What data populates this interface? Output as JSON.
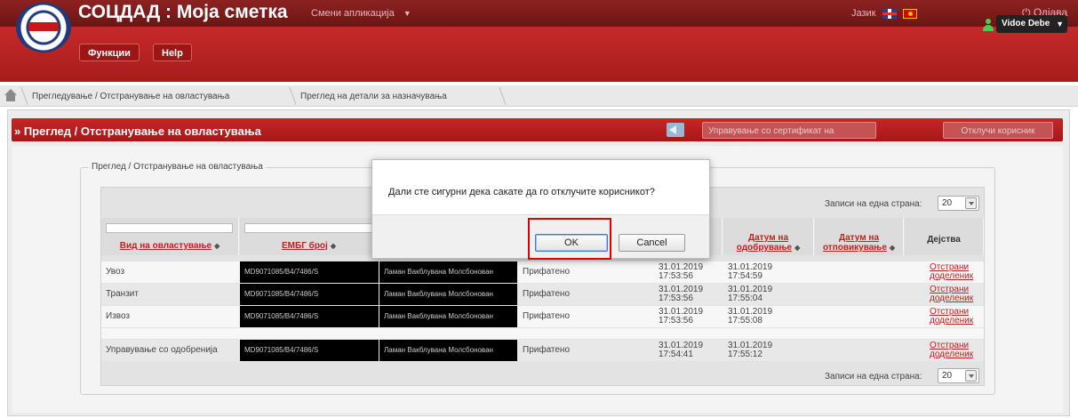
{
  "header": {
    "app_title": "СОЦДАД : Моја сметка",
    "switch_app_label": "Смени апликација",
    "language_label": "Јазик",
    "logout_label": "Одјава"
  },
  "subheader": {
    "functions_button": "Функции",
    "help_button": "Help",
    "user_name": "Vidoe Debe"
  },
  "breadcrumb": {
    "items": [
      "Прегледување / Отстранување на овластувања",
      "Преглед на детали за назначувања"
    ]
  },
  "page": {
    "title": "» Преглед / Отстранување на овластувања",
    "buttons": {
      "manage_cert": "Управување со сертификат на корисник",
      "unlock_user": "Отклучи корисник"
    },
    "fieldset_legend": "Преглед / Отстранување на овластувања"
  },
  "table": {
    "per_page_label": "Записи на една страна:",
    "per_page_value": "20",
    "columns": {
      "authorization_type": "Вид на овластување",
      "embg": "ЕМБГ број",
      "approval_date": "Датум на одобрување",
      "revocation_date": "Датум на отповикување",
      "actions": "Дејства"
    },
    "rows": [
      {
        "type": "Увоз",
        "embg": "MD9071085/В4/7486/S",
        "name": "Ламан Вакблувана Молсбонован",
        "status": "Прифатено",
        "date1": "31.01.2019",
        "time1": "17:53:56",
        "date2": "31.01.2019",
        "time2": "17:54:59",
        "action_line1": "Отстрани",
        "action_line2": "доделеник"
      },
      {
        "type": "Транзит",
        "embg": "MD9071085/В4/7486/S",
        "name": "Ламан Вакблувана Молсбонован",
        "status": "Прифатено",
        "date1": "31.01.2019",
        "time1": "17:53:56",
        "date2": "31.01.2019",
        "time2": "17:55:04",
        "action_line1": "Отстрани",
        "action_line2": "доделеник"
      },
      {
        "type": "Извоз",
        "embg": "MD9071085/В4/7486/S",
        "name": "Ламан Вакблувана Молсбонован",
        "status": "Прифатено",
        "date1": "31.01.2019",
        "time1": "17:53:56",
        "date2": "31.01.2019",
        "time2": "17:55:08",
        "action_line1": "Отстрани",
        "action_line2": "доделеник"
      },
      {
        "type": "Управување со одобренија",
        "embg": "MD9071085/В4/7486/S",
        "name": "Ламан Вакблувана Молсбонован",
        "status": "Прифатено",
        "date1": "31.01.2019",
        "time1": "17:54:41",
        "date2": "31.01.2019",
        "time2": "17:55:12",
        "action_line1": "Отстрани",
        "action_line2": "доделеник"
      }
    ]
  },
  "dialog": {
    "message": "Дали сте сигурни дека сакате да го отклучите корисникот?",
    "ok_label": "OK",
    "cancel_label": "Cancel"
  },
  "colors": {
    "header_red": "#7c1a1a",
    "accent_red": "#b71f1f",
    "link_red": "#c02121",
    "highlight": "#e00000"
  }
}
